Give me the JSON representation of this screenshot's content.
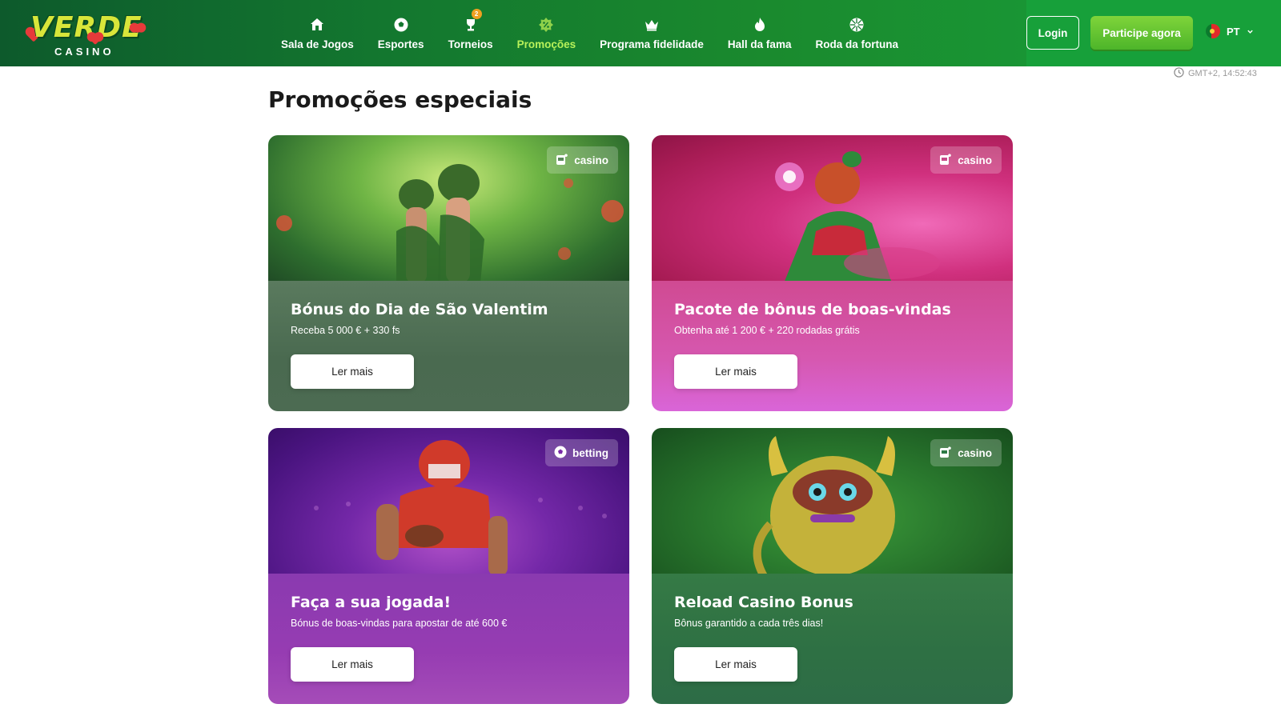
{
  "header": {
    "logo": {
      "word": "VERDE",
      "sub": "CASINO"
    },
    "nav": [
      {
        "label": "Sala de Jogos",
        "icon": "home-icon",
        "active": false
      },
      {
        "label": "Esportes",
        "icon": "soccer-ball-icon",
        "active": false
      },
      {
        "label": "Torneios",
        "icon": "trophy-icon",
        "active": false,
        "badge": "2"
      },
      {
        "label": "Promoções",
        "icon": "promo-badge-icon",
        "active": true
      },
      {
        "label": "Programa fidelidade",
        "icon": "crown-icon",
        "active": false
      },
      {
        "label": "Hall da fama",
        "icon": "fire-icon",
        "active": false
      },
      {
        "label": "Roda da fortuna",
        "icon": "wheel-icon",
        "active": false
      }
    ],
    "login_label": "Login",
    "join_label": "Participe agora",
    "language": "PT",
    "clock": "GMT+2, 14:52:43"
  },
  "page": {
    "title": "Promoções especiais"
  },
  "promotions": [
    {
      "tag": "casino",
      "title": "Bónus do Dia de São Valentim",
      "subtitle": "Receba 5 000 € + 330 fs",
      "button": "Ler mais"
    },
    {
      "tag": "casino",
      "title": "Pacote de bônus de boas-vindas",
      "subtitle": "Obtenha até 1 200 € + 220 rodadas grátis",
      "button": "Ler mais"
    },
    {
      "tag": "betting",
      "title": "Faça a sua jogada!",
      "subtitle": "Bónus de boas-vindas para apostar de até 600 €",
      "button": "Ler mais"
    },
    {
      "tag": "casino",
      "title": "Reload Casino Bonus",
      "subtitle": "Bônus garantido a cada três dias!",
      "button": "Ler mais"
    }
  ],
  "colors": {
    "header_green": "#13772f",
    "active_nav": "#b8f25a",
    "join_button": "#4db52a"
  }
}
